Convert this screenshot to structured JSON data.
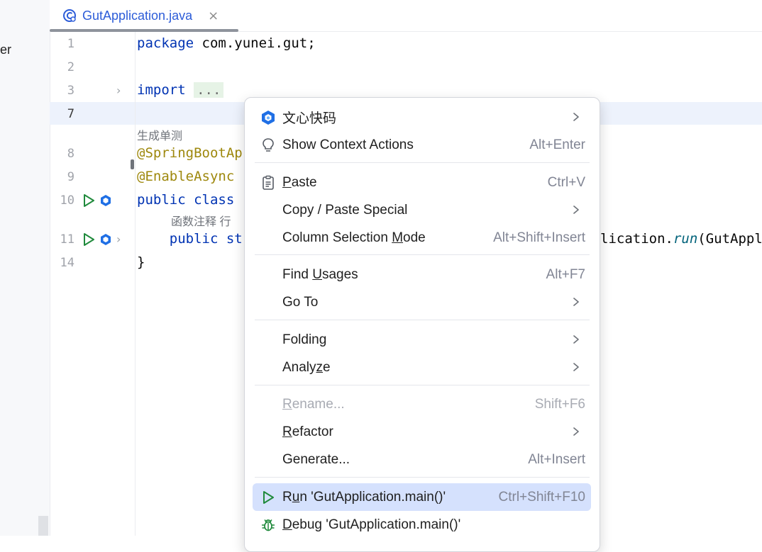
{
  "left_panel": {
    "label_fragment": "er"
  },
  "tab": {
    "title": "GutApplication.java",
    "close": "×"
  },
  "editor": {
    "lines": [
      {
        "num": "1",
        "tokens": [
          {
            "t": "package",
            "c": "kw"
          },
          {
            "t": " com.yunei.gut;",
            "c": ""
          }
        ]
      },
      {
        "num": "2",
        "tokens": []
      },
      {
        "num": "3",
        "tokens": [
          {
            "t": "import",
            "c": "kw"
          },
          {
            "t": " ",
            "c": ""
          },
          {
            "t": "...",
            "c": "fold-ph"
          }
        ]
      },
      {
        "num": "7",
        "tokens": []
      },
      {
        "num": "8",
        "tokens": [
          {
            "t": "@SpringBootAp",
            "c": "anno"
          }
        ]
      },
      {
        "num": "9",
        "tokens": [
          {
            "t": "@EnableAsync",
            "c": "anno"
          }
        ]
      },
      {
        "num": "10",
        "tokens": [
          {
            "t": "public",
            "c": "kw"
          },
          {
            "t": " ",
            "c": ""
          },
          {
            "t": "class",
            "c": "kw"
          }
        ]
      },
      {
        "num": "11",
        "tokens": [
          {
            "t": "    ",
            "c": ""
          },
          {
            "t": "public",
            "c": "kw"
          },
          {
            "t": " st",
            "c": "kw"
          }
        ]
      },
      {
        "num": "14",
        "tokens": [
          {
            "t": "}",
            "c": ""
          }
        ]
      }
    ],
    "inlay_generate_test": "生成单测",
    "inlay_method_hint": "函数注释  行",
    "code_tail_prefix": "lication.",
    "code_tail_method": "run",
    "code_tail_suffix": "(GutAppl"
  },
  "context_menu": {
    "items": [
      {
        "id": "wenxin",
        "icon": "wenxin-logo-icon",
        "label": "文心快码",
        "mnemonic": "",
        "shortcut": "",
        "submenu": true,
        "disabled": false,
        "selected": false
      },
      {
        "id": "show-context-actions",
        "icon": "bulb-icon",
        "label": "Show Context Actions",
        "mnemonic": "",
        "shortcut": "Alt+Enter",
        "submenu": false,
        "disabled": false,
        "selected": false
      },
      {
        "id": "paste",
        "icon": "clipboard-icon",
        "label": "Paste",
        "mnemonic": "P",
        "shortcut": "Ctrl+V",
        "submenu": false,
        "disabled": false,
        "selected": false
      },
      {
        "id": "copy-paste-special",
        "icon": "",
        "label": "Copy / Paste Special",
        "mnemonic": "",
        "shortcut": "",
        "submenu": true,
        "disabled": false,
        "selected": false
      },
      {
        "id": "column-selection-mode",
        "icon": "",
        "label": "Column Selection Mode",
        "mnemonic": "M",
        "shortcut": "Alt+Shift+Insert",
        "submenu": false,
        "disabled": false,
        "selected": false
      },
      {
        "id": "find-usages",
        "icon": "",
        "label": "Find Usages",
        "mnemonic": "U",
        "shortcut": "Alt+F7",
        "submenu": false,
        "disabled": false,
        "selected": false
      },
      {
        "id": "go-to",
        "icon": "",
        "label": "Go To",
        "mnemonic": "",
        "shortcut": "",
        "submenu": true,
        "disabled": false,
        "selected": false
      },
      {
        "id": "folding",
        "icon": "",
        "label": "Folding",
        "mnemonic": "",
        "shortcut": "",
        "submenu": true,
        "disabled": false,
        "selected": false
      },
      {
        "id": "analyze",
        "icon": "",
        "label": "Analyze",
        "mnemonic": "z",
        "shortcut": "",
        "submenu": true,
        "disabled": false,
        "selected": false
      },
      {
        "id": "rename",
        "icon": "",
        "label": "Rename...",
        "mnemonic": "R",
        "shortcut": "Shift+F6",
        "submenu": false,
        "disabled": true,
        "selected": false
      },
      {
        "id": "refactor",
        "icon": "",
        "label": "Refactor",
        "mnemonic": "R",
        "shortcut": "",
        "submenu": true,
        "disabled": false,
        "selected": false
      },
      {
        "id": "generate",
        "icon": "",
        "label": "Generate...",
        "mnemonic": "",
        "shortcut": "Alt+Insert",
        "submenu": false,
        "disabled": false,
        "selected": false
      },
      {
        "id": "run-main",
        "icon": "run-icon",
        "label": "Run 'GutApplication.main()'",
        "mnemonic": "u",
        "shortcut": "Ctrl+Shift+F10",
        "submenu": false,
        "disabled": false,
        "selected": true
      },
      {
        "id": "debug-main",
        "icon": "debug-icon",
        "label": "Debug 'GutApplication.main()'",
        "mnemonic": "D",
        "shortcut": "",
        "submenu": false,
        "disabled": false,
        "selected": false
      }
    ]
  },
  "colors": {
    "accent": "#2c5cd8",
    "selection": "#d5e1fd",
    "keyword": "#0033b3",
    "annotation": "#9e880d",
    "run_green": "#208a3c"
  }
}
